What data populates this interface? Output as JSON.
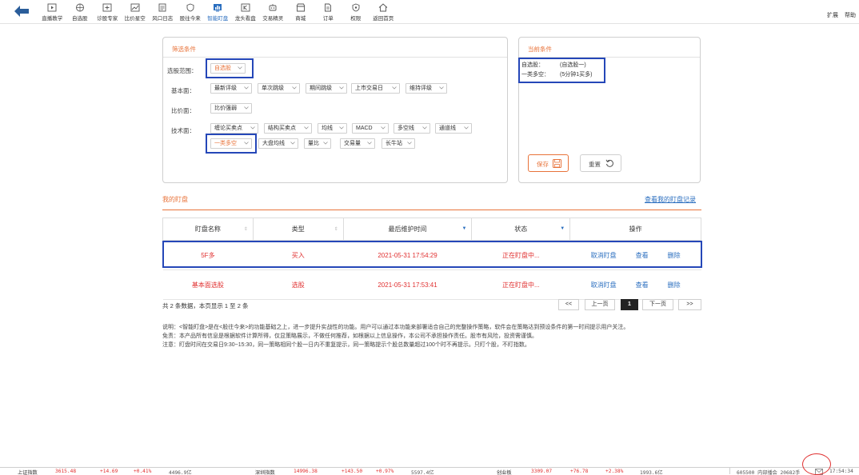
{
  "toolbar": {
    "items": [
      {
        "label": "直播教学",
        "icon": "play-icon"
      },
      {
        "label": "自选股",
        "icon": "globe-icon"
      },
      {
        "label": "诊股专家",
        "icon": "stock-doctor-icon"
      },
      {
        "label": "比价星空",
        "icon": "chart-icon"
      },
      {
        "label": "风口日志",
        "icon": "document-icon"
      },
      {
        "label": "股往今来",
        "icon": "shield-icon"
      },
      {
        "label": "智能盯盘",
        "icon": "monitor-chart-icon",
        "active": true
      },
      {
        "label": "龙头看盘",
        "icon": "k-chart-icon"
      },
      {
        "label": "交易精灵",
        "icon": "robot-icon"
      },
      {
        "label": "商城",
        "icon": "shop-icon"
      },
      {
        "label": "订单",
        "icon": "order-icon"
      },
      {
        "label": "权限",
        "icon": "permission-icon"
      },
      {
        "label": "返回首页",
        "icon": "home-icon"
      }
    ],
    "right": [
      "扩展",
      "帮助"
    ]
  },
  "filter": {
    "title": "筛选条件",
    "scope_label": "选股范围：",
    "scope_value": "自选股",
    "fundamental_label": "基本面：",
    "fundamental": [
      "最新评级",
      "单次跳级",
      "期间跳级",
      "上市交易日",
      "维持评级"
    ],
    "price_label": "比价面：",
    "price": [
      "比价强弱"
    ],
    "tech_label": "技术面：",
    "tech_row1": [
      "缠论买卖点",
      "结构买卖点",
      "均线",
      "MACD",
      "多空线",
      "通道线"
    ],
    "tech_row2": [
      "一类多空",
      "大盘均线",
      "量比",
      "交易量",
      "长牛站"
    ]
  },
  "current": {
    "title": "当前条件",
    "items": [
      {
        "key": "自选股：",
        "value": "(自选股一)"
      },
      {
        "key": "一类多空：",
        "value": "(5分钟1买多)"
      }
    ],
    "save_label": "保存",
    "reset_label": "重置"
  },
  "watch": {
    "title": "我的盯盘",
    "history_link": "查看我的盯盘记录",
    "columns": [
      "盯盘名称",
      "类型",
      "最后维护时间",
      "状态",
      "操作"
    ],
    "rows": [
      {
        "name": "5F多",
        "type": "买入",
        "time": "2021-05-31 17:54:29",
        "status": "正在盯盘中...",
        "ops": [
          "取消盯盘",
          "查看",
          "删除"
        ]
      },
      {
        "name": "基本面选股",
        "type": "选股",
        "time": "2021-05-31 17:53:41",
        "status": "正在盯盘中...",
        "ops": [
          "取消盯盘",
          "查看",
          "删除"
        ]
      }
    ],
    "summary": "共 2 条数据，本页显示 1 至 2 条",
    "pager": {
      "first": "<<",
      "prev": "上一页",
      "current": "1",
      "next": "下一页",
      "last": ">>"
    }
  },
  "notes": [
    "说明：<智能盯盘>是在<股往今来>的功能基础之上，进一步提升实战性的功能。用户可以通过本功能来部署适合自己的完整操作策略，软件会在策略达到预设条件的第一时间提示用户关注。",
    "免责：本产品所有信息是根据软件计算所得，仅显策略展示，不做任何推荐，如根据以上信息操作，本公司不承担操作责任。股市有风险，投资需谨慎。",
    "注意：盯盘时间在交易日9:30~15:30，同一策略相同个股一日内不重复提示，同一策略提示个股总数量超过100个时不再提示。只盯个股，不盯指数。"
  ],
  "statusbar": {
    "sh": {
      "name": "上证指数",
      "value": "3615.48",
      "change": "+14.69",
      "pct": "+0.41%",
      "amount": "4496.9亿"
    },
    "sz": {
      "name": "深圳指数",
      "value": "14996.38",
      "change": "+143.50",
      "pct": "+0.97%",
      "amount": "5597.4亿"
    },
    "cy": {
      "name": "创业板",
      "value": "3309.07",
      "change": "+76.78",
      "pct": "+2.38%",
      "amount": "1993.6亿"
    },
    "ticker": "605500 内部播会 20682手",
    "time": "17:54:34"
  },
  "colors": {
    "accent": "#e8733a",
    "link": "#2a6ebf",
    "up": "#e03030",
    "highlight": "#2547b8"
  }
}
